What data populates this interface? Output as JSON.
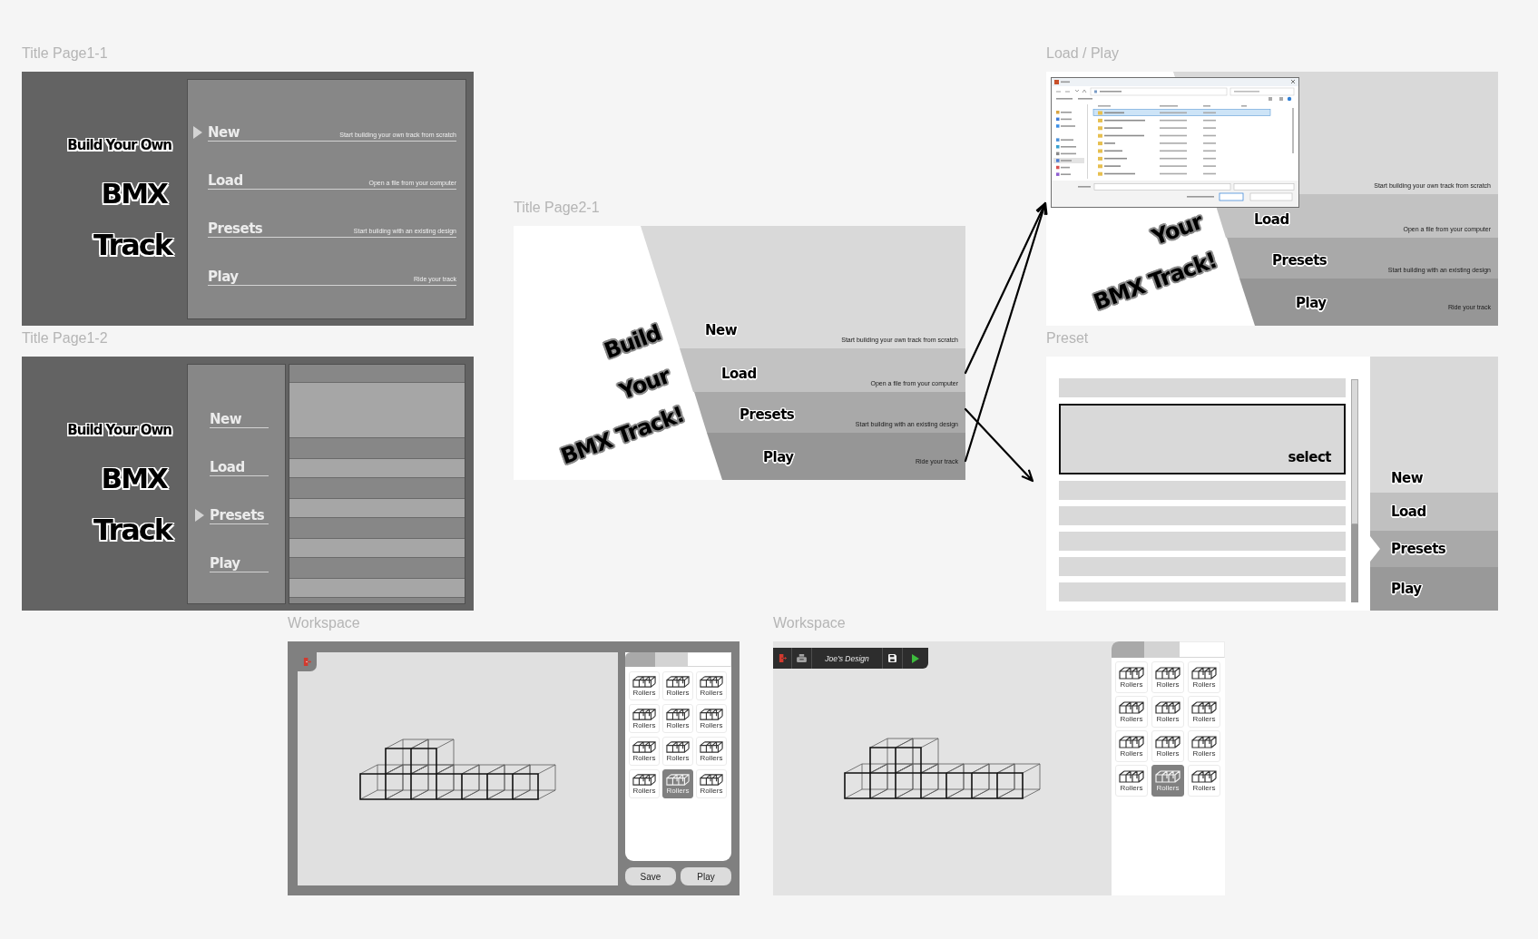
{
  "frames": [
    {
      "kind": "title_menu",
      "label": "Title Page1-1",
      "title_lines": [
        "Build Your Own",
        "BMX",
        "Track"
      ],
      "menu": [
        {
          "label": "New",
          "description": "Start building your own track from scratch",
          "selected": true
        },
        {
          "label": "Load",
          "description": "Open a file from your computer",
          "selected": false
        },
        {
          "label": "Presets",
          "description": "Start building with an existing design",
          "selected": false
        },
        {
          "label": "Play",
          "description": "Ride your track",
          "selected": false
        }
      ]
    },
    {
      "kind": "title_menu",
      "label": "Title Page1-2",
      "title_lines": [
        "Build Your Own",
        "BMX",
        "Track"
      ],
      "menu": [
        {
          "label": "New",
          "selected": false
        },
        {
          "label": "Load",
          "selected": false
        },
        {
          "label": "Presets",
          "selected": true
        },
        {
          "label": "Play",
          "selected": false
        }
      ],
      "preset_list": [
        {
          "selected": true
        },
        {
          "selected": false
        },
        {
          "selected": false
        },
        {
          "selected": false
        },
        {
          "selected": false
        }
      ]
    },
    {
      "kind": "diagonal_menu",
      "label": "Title Page2-1",
      "title_words": [
        "Build",
        "Your",
        "BMX Track!"
      ],
      "menu": [
        {
          "label": "New",
          "description": "Start building your own track from scratch"
        },
        {
          "label": "Load",
          "description": "Open a file from your computer"
        },
        {
          "label": "Presets",
          "description": "Start building with an existing design"
        },
        {
          "label": "Play",
          "description": "Ride your track"
        }
      ]
    },
    {
      "kind": "diagonal_menu",
      "label": "Load / Play",
      "file_dialog": true,
      "title_words": [
        "Your",
        "BMX Track!"
      ],
      "menu": [
        {
          "description": "Start building your own track from scratch"
        },
        {
          "label": "Load",
          "description": "Open a file from your computer"
        },
        {
          "label": "Presets",
          "description": "Start building with an existing design"
        },
        {
          "label": "Play",
          "description": "Ride your track"
        }
      ]
    },
    {
      "kind": "preset_picker",
      "label": "Preset",
      "preset_list": [
        {
          "selected": false
        },
        {
          "selected": true,
          "label": "select"
        },
        {
          "selected": false
        },
        {
          "selected": false
        },
        {
          "selected": false
        },
        {
          "selected": false
        },
        {
          "selected": false
        }
      ],
      "menu": [
        {
          "label": "New",
          "selected": false
        },
        {
          "label": "Load",
          "selected": false
        },
        {
          "label": "Presets",
          "selected": true
        },
        {
          "label": "Play",
          "selected": false
        }
      ]
    },
    {
      "kind": "workspace_buttons",
      "label": "Workspace",
      "palette": {
        "tabs": [
          {
            "selected": false
          },
          {
            "selected": false
          },
          {
            "selected": true
          }
        ],
        "items": [
          {
            "label": "Rollers",
            "selected": false
          },
          {
            "label": "Rollers",
            "selected": false
          },
          {
            "label": "Rollers",
            "selected": false
          },
          {
            "label": "Rollers",
            "selected": false
          },
          {
            "label": "Rollers",
            "selected": false
          },
          {
            "label": "Rollers",
            "selected": false
          },
          {
            "label": "Rollers",
            "selected": false
          },
          {
            "label": "Rollers",
            "selected": false
          },
          {
            "label": "Rollers",
            "selected": false
          },
          {
            "label": "Rollers",
            "selected": false
          },
          {
            "label": "Rollers",
            "selected": true
          },
          {
            "label": "Rollers",
            "selected": false
          }
        ]
      },
      "buttons": [
        "Save",
        "Play"
      ]
    },
    {
      "kind": "workspace_toolbar",
      "label": "Workspace",
      "toolbar": {
        "title": "Joe’s Design"
      },
      "palette": {
        "tabs": [
          {
            "selected": false
          },
          {
            "selected": false
          },
          {
            "selected": true
          }
        ],
        "items": [
          {
            "label": "Rollers",
            "selected": false
          },
          {
            "label": "Rollers",
            "selected": false
          },
          {
            "label": "Rollers",
            "selected": false
          },
          {
            "label": "Rollers",
            "selected": false
          },
          {
            "label": "Rollers",
            "selected": false
          },
          {
            "label": "Rollers",
            "selected": false
          },
          {
            "label": "Rollers",
            "selected": false
          },
          {
            "label": "Rollers",
            "selected": false
          },
          {
            "label": "Rollers",
            "selected": false
          },
          {
            "label": "Rollers",
            "selected": false
          },
          {
            "label": "Rollers",
            "selected": true
          },
          {
            "label": "Rollers",
            "selected": false
          }
        ]
      }
    }
  ]
}
